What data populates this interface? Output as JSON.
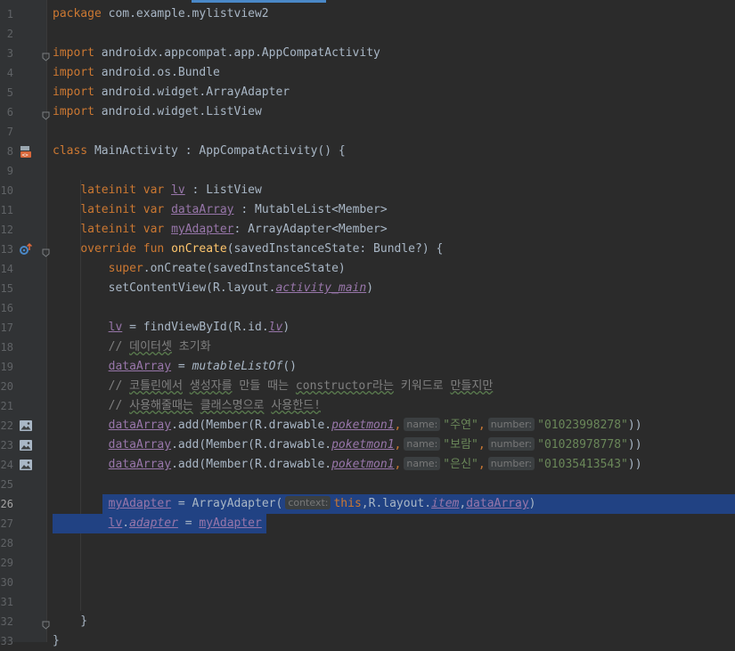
{
  "editor": {
    "lines": [
      {
        "n": "1",
        "tokens": [
          {
            "t": "package",
            "c": "kw"
          },
          {
            "t": " com.example.mylistview2"
          }
        ]
      },
      {
        "n": "2",
        "tokens": []
      },
      {
        "n": "3",
        "fold": true,
        "tokens": [
          {
            "t": "import",
            "c": "kw"
          },
          {
            "t": " androidx.appcompat.app.AppCompatActivity"
          }
        ]
      },
      {
        "n": "4",
        "tokens": [
          {
            "t": "import",
            "c": "kw"
          },
          {
            "t": " android.os.Bundle"
          }
        ]
      },
      {
        "n": "5",
        "tokens": [
          {
            "t": "import",
            "c": "kw"
          },
          {
            "t": " android.widget.ArrayAdapter"
          }
        ]
      },
      {
        "n": "6",
        "fold": true,
        "tokens": [
          {
            "t": "import",
            "c": "kw"
          },
          {
            "t": " android.widget.ListView"
          }
        ]
      },
      {
        "n": "7",
        "tokens": []
      },
      {
        "n": "8",
        "icon": "android-activity-icon",
        "tokens": [
          {
            "t": "class",
            "c": "kw"
          },
          {
            "t": " MainActivity : AppCompatActivity() {"
          }
        ]
      },
      {
        "n": "9",
        "tokens": []
      },
      {
        "n": "10",
        "tokens": [
          {
            "t": "    "
          },
          {
            "t": "lateinit var",
            "c": "kw"
          },
          {
            "t": " "
          },
          {
            "t": "lv",
            "c": "prop"
          },
          {
            "t": " : ListView"
          }
        ]
      },
      {
        "n": "11",
        "tokens": [
          {
            "t": "    "
          },
          {
            "t": "lateinit var",
            "c": "kw"
          },
          {
            "t": " "
          },
          {
            "t": "dataArray",
            "c": "prop"
          },
          {
            "t": " : MutableList<Member>"
          }
        ]
      },
      {
        "n": "12",
        "tokens": [
          {
            "t": "    "
          },
          {
            "t": "lateinit var",
            "c": "kw"
          },
          {
            "t": " "
          },
          {
            "t": "myAdapter",
            "c": "prop"
          },
          {
            "t": ": ArrayAdapter<Member>"
          }
        ]
      },
      {
        "n": "13",
        "icon": "override-icon",
        "fold": true,
        "tokens": [
          {
            "t": "    "
          },
          {
            "t": "override fun",
            "c": "kw"
          },
          {
            "t": " "
          },
          {
            "t": "onCreate",
            "c": "fn"
          },
          {
            "t": "(savedInstanceState: Bundle?) {"
          }
        ]
      },
      {
        "n": "14",
        "tokens": [
          {
            "t": "        "
          },
          {
            "t": "super",
            "c": "kw"
          },
          {
            "t": ".onCreate(savedInstanceState)"
          }
        ]
      },
      {
        "n": "15",
        "tokens": [
          {
            "t": "        setContentView(R.layout."
          },
          {
            "t": "activity_main",
            "c": "res"
          },
          {
            "t": ")"
          }
        ]
      },
      {
        "n": "16",
        "tokens": []
      },
      {
        "n": "17",
        "tokens": [
          {
            "t": "        "
          },
          {
            "t": "lv",
            "c": "prop"
          },
          {
            "t": " = findViewById(R.id."
          },
          {
            "t": "lv",
            "c": "res"
          },
          {
            "t": ")"
          }
        ]
      },
      {
        "n": "18",
        "tokens": [
          {
            "t": "        "
          },
          {
            "t": "// ",
            "c": "com"
          },
          {
            "t": "데이터셋",
            "c": "com wavy"
          },
          {
            "t": " 초기화",
            "c": "com"
          }
        ]
      },
      {
        "n": "19",
        "tokens": [
          {
            "t": "        "
          },
          {
            "t": "dataArray",
            "c": "prop"
          },
          {
            "t": " = "
          },
          {
            "t": "mutableListOf",
            "c": "ext"
          },
          {
            "t": "()"
          }
        ]
      },
      {
        "n": "20",
        "tokens": [
          {
            "t": "        "
          },
          {
            "t": "// ",
            "c": "com"
          },
          {
            "t": "코틀린에서",
            "c": "com wavy"
          },
          {
            "t": " ",
            "c": "com"
          },
          {
            "t": "생성자를",
            "c": "com wavy"
          },
          {
            "t": " 만들 때는 ",
            "c": "com"
          },
          {
            "t": "constructor라는",
            "c": "com wavy"
          },
          {
            "t": " 키워드로 ",
            "c": "com"
          },
          {
            "t": "만들지만",
            "c": "com wavy"
          }
        ]
      },
      {
        "n": "21",
        "tokens": [
          {
            "t": "        "
          },
          {
            "t": "// ",
            "c": "com"
          },
          {
            "t": "사용해줄때는",
            "c": "com wavy"
          },
          {
            "t": " ",
            "c": "com"
          },
          {
            "t": "클래스명으로",
            "c": "com wavy"
          },
          {
            "t": " ",
            "c": "com"
          },
          {
            "t": "사용한드!",
            "c": "com wavy"
          }
        ]
      },
      {
        "n": "22",
        "icon": "image-icon",
        "tokens": [
          {
            "t": "        "
          },
          {
            "t": "dataArray",
            "c": "prop"
          },
          {
            "t": ".add(Member(R.drawable."
          },
          {
            "t": "poketmon1",
            "c": "res"
          },
          {
            "t": ",",
            "c": "kw"
          },
          {
            "t": "name:",
            "h": true
          },
          {
            "t": "\"주연\"",
            "c": "str"
          },
          {
            "t": ",",
            "c": "kw"
          },
          {
            "t": "number:",
            "h": true
          },
          {
            "t": "\"01023998278\"",
            "c": "str"
          },
          {
            "t": "))"
          }
        ]
      },
      {
        "n": "23",
        "icon": "image-icon",
        "tokens": [
          {
            "t": "        "
          },
          {
            "t": "dataArray",
            "c": "prop"
          },
          {
            "t": ".add(Member(R.drawable."
          },
          {
            "t": "poketmon1",
            "c": "res"
          },
          {
            "t": ",",
            "c": "kw"
          },
          {
            "t": "name:",
            "h": true
          },
          {
            "t": "\"보람\"",
            "c": "str"
          },
          {
            "t": ",",
            "c": "kw"
          },
          {
            "t": "number:",
            "h": true
          },
          {
            "t": "\"01028978778\"",
            "c": "str"
          },
          {
            "t": "))"
          }
        ]
      },
      {
        "n": "24",
        "icon": "image-icon",
        "tokens": [
          {
            "t": "        "
          },
          {
            "t": "dataArray",
            "c": "prop"
          },
          {
            "t": ".add(Member(R.drawable."
          },
          {
            "t": "poketmon1",
            "c": "res"
          },
          {
            "t": ",",
            "c": "kw"
          },
          {
            "t": "name:",
            "h": true
          },
          {
            "t": "\"은신\"",
            "c": "str"
          },
          {
            "t": ",",
            "c": "kw"
          },
          {
            "t": "number:",
            "h": true
          },
          {
            "t": "\"01035413543\"",
            "c": "str"
          },
          {
            "t": "))"
          }
        ]
      },
      {
        "n": "25",
        "tokens": []
      },
      {
        "n": "26",
        "current": true,
        "sel": "block",
        "tokens": [
          {
            "t": "        "
          },
          {
            "t": "myAdapter",
            "c": "prop"
          },
          {
            "t": " = ArrayAdapter("
          },
          {
            "t": "context:",
            "h": true
          },
          {
            "t": "this",
            "c": "kw"
          },
          {
            "t": ",R.layout."
          },
          {
            "t": "item",
            "c": "res"
          },
          {
            "t": ","
          },
          {
            "t": "dataArray",
            "c": "prop"
          },
          {
            "t": ")"
          }
        ]
      },
      {
        "n": "27",
        "sel": "line",
        "tokens": [
          {
            "t": "        "
          },
          {
            "t": "lv",
            "c": "prop"
          },
          {
            "t": "."
          },
          {
            "t": "adapter",
            "c": "prop-i"
          },
          {
            "t": " = "
          },
          {
            "t": "myAdapter",
            "c": "prop"
          }
        ]
      },
      {
        "n": "28",
        "tokens": []
      },
      {
        "n": "29",
        "tokens": []
      },
      {
        "n": "30",
        "tokens": []
      },
      {
        "n": "31",
        "tokens": []
      },
      {
        "n": "32",
        "fold": true,
        "tokens": [
          {
            "t": "    }"
          }
        ]
      },
      {
        "n": "33",
        "tokens": [
          {
            "t": "}"
          }
        ]
      }
    ]
  },
  "colors": {
    "background": "#2b2b2b",
    "gutter": "#313335",
    "selection": "#214283",
    "accent": "#4a88c7"
  }
}
